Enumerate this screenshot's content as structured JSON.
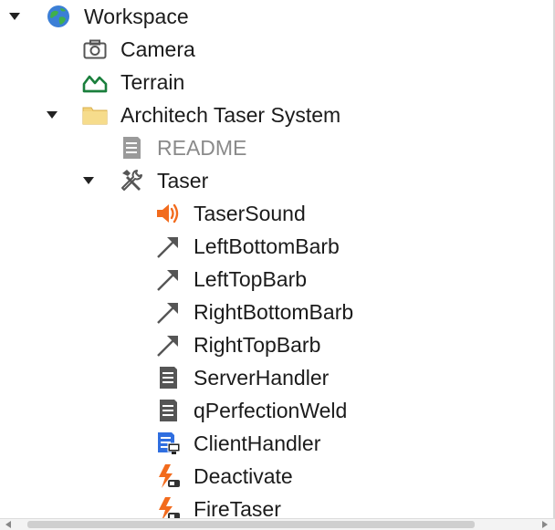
{
  "explorer": {
    "items": [
      {
        "label": "Workspace",
        "icon": "globe-icon",
        "expanded": true
      },
      {
        "label": "Camera",
        "icon": "camera-icon"
      },
      {
        "label": "Terrain",
        "icon": "terrain-icon"
      },
      {
        "label": "Architech Taser System",
        "icon": "folder-icon",
        "expanded": true
      },
      {
        "label": "README",
        "icon": "script-icon",
        "muted": true
      },
      {
        "label": "Taser",
        "icon": "tool-icon",
        "expanded": true
      },
      {
        "label": "TaserSound",
        "icon": "sound-icon"
      },
      {
        "label": "LeftBottomBarb",
        "icon": "attachment-arrow-icon"
      },
      {
        "label": "LeftTopBarb",
        "icon": "attachment-arrow-icon"
      },
      {
        "label": "RightBottomBarb",
        "icon": "attachment-arrow-icon"
      },
      {
        "label": "RightTopBarb",
        "icon": "attachment-arrow-icon"
      },
      {
        "label": "ServerHandler",
        "icon": "script-icon"
      },
      {
        "label": "qPerfectionWeld",
        "icon": "script-icon"
      },
      {
        "label": "ClientHandler",
        "icon": "local-script-icon"
      },
      {
        "label": "Deactivate",
        "icon": "remote-event-icon"
      },
      {
        "label": "FireTaser",
        "icon": "remote-event-icon"
      }
    ]
  },
  "colors": {
    "folder": "#f2d27a",
    "terrain": "#1a7f3c",
    "sound": "#f26b1d",
    "local_script_blue": "#2f6ee0",
    "event_orange": "#f26b1d",
    "icon_gray": "#555555"
  }
}
